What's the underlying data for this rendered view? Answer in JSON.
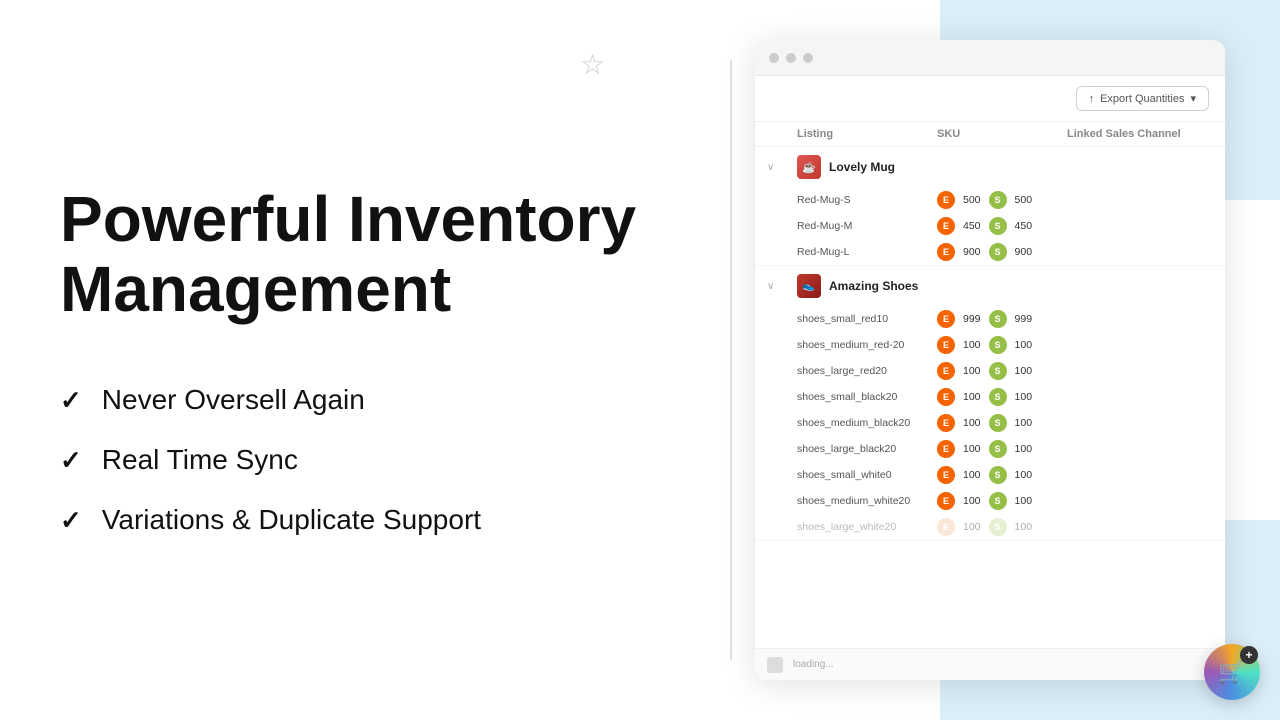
{
  "background": {
    "colors": {
      "blue_accent": "#daeef8",
      "divider": "#e0e0e0"
    }
  },
  "left_panel": {
    "title_line1": "Powerful Inventory",
    "title_line2": "Management",
    "features": [
      {
        "id": "f1",
        "label": "Never Oversell Again"
      },
      {
        "id": "f2",
        "label": "Real Time Sync"
      },
      {
        "id": "f3",
        "label": "Variations & Duplicate Support"
      }
    ],
    "check_symbol": "✓"
  },
  "browser": {
    "export_button": "Export Quantities",
    "table": {
      "headers": {
        "listing": "Listing",
        "sku": "SKU",
        "linked_sales_channel": "Linked Sales Channel"
      },
      "products": [
        {
          "name": "Lovely Mug",
          "icon": "mug",
          "skus": [
            {
              "sku": "Red-Mug-S",
              "etsy_qty": "500",
              "shopify_qty": "500"
            },
            {
              "sku": "Red-Mug-M",
              "etsy_qty": "450",
              "shopify_qty": "450"
            },
            {
              "sku": "Red-Mug-L",
              "etsy_qty": "900",
              "shopify_qty": "900"
            }
          ]
        },
        {
          "name": "Amazing Shoes",
          "icon": "shoes",
          "skus": [
            {
              "sku": "shoes_small_red10",
              "etsy_qty": "999",
              "shopify_qty": "999"
            },
            {
              "sku": "shoes_medium_red-20",
              "etsy_qty": "100",
              "shopify_qty": "100"
            },
            {
              "sku": "shoes_large_red20",
              "etsy_qty": "100",
              "shopify_qty": "100"
            },
            {
              "sku": "shoes_small_black20",
              "etsy_qty": "100",
              "shopify_qty": "100"
            },
            {
              "sku": "shoes_medium_black20",
              "etsy_qty": "100",
              "shopify_qty": "100"
            },
            {
              "sku": "shoes_large_black20",
              "etsy_qty": "100",
              "shopify_qty": "100"
            },
            {
              "sku": "shoes_small_white0",
              "etsy_qty": "100",
              "shopify_qty": "100"
            },
            {
              "sku": "shoes_medium_white20",
              "etsy_qty": "100",
              "shopify_qty": "100"
            },
            {
              "sku": "shoes_large_white20",
              "etsy_qty": "100",
              "shopify_qty": "100",
              "faded": true
            }
          ]
        }
      ]
    }
  },
  "icons": {
    "star": "☆",
    "check": "✓",
    "cart": "🛒",
    "plus": "+",
    "export_arrow": "↑",
    "chevron_down": "∨",
    "etsy_letter": "E",
    "shopify_letter": "S"
  }
}
